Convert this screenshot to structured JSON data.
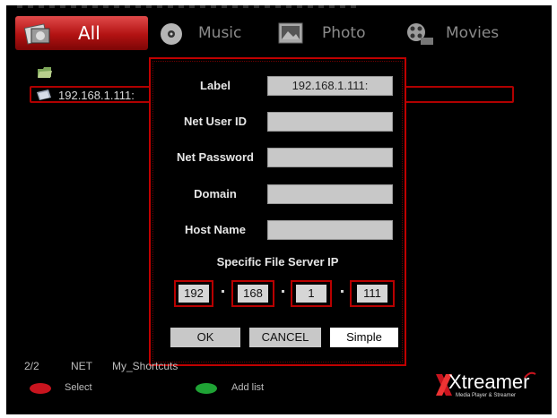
{
  "tabs": [
    {
      "label": "All",
      "icon": "all-media-icon",
      "active": true
    },
    {
      "label": "Music",
      "icon": "disc-icon",
      "active": false
    },
    {
      "label": "Photo",
      "icon": "photo-icon",
      "active": false
    },
    {
      "label": "Movies",
      "icon": "film-reel-icon",
      "active": false
    }
  ],
  "file_list": {
    "items": [
      {
        "label": "",
        "icon": "parent-folder-icon"
      },
      {
        "label": "192.168.1.111:",
        "icon": "network-folder-icon",
        "selected": true
      }
    ]
  },
  "dialog": {
    "fields": [
      {
        "label": "Label",
        "value": "192.168.1.111:"
      },
      {
        "label": "Net User ID",
        "value": ""
      },
      {
        "label": "Net Password",
        "value": ""
      },
      {
        "label": "Domain",
        "value": ""
      },
      {
        "label": "Host Name",
        "value": ""
      }
    ],
    "ip_section_title": "Specific File Server IP",
    "ip": [
      "192",
      "168",
      "1",
      "111"
    ],
    "buttons": {
      "ok": "OK",
      "cancel": "CANCEL",
      "simple": "Simple"
    }
  },
  "status": {
    "page": "2/2",
    "source": "NET",
    "path": "My_Shortcuts"
  },
  "keys": [
    {
      "color": "#c8141e",
      "label": "Select"
    },
    {
      "color": "#1fa335",
      "label": "Add list"
    }
  ],
  "brand": {
    "name": "Xtreamer",
    "tagline": "Media Player & Streamer",
    "accent": "#c8141e"
  },
  "colors": {
    "background": "#000000",
    "accent_red": "#c00000",
    "field_gray": "#c8c8c8"
  }
}
